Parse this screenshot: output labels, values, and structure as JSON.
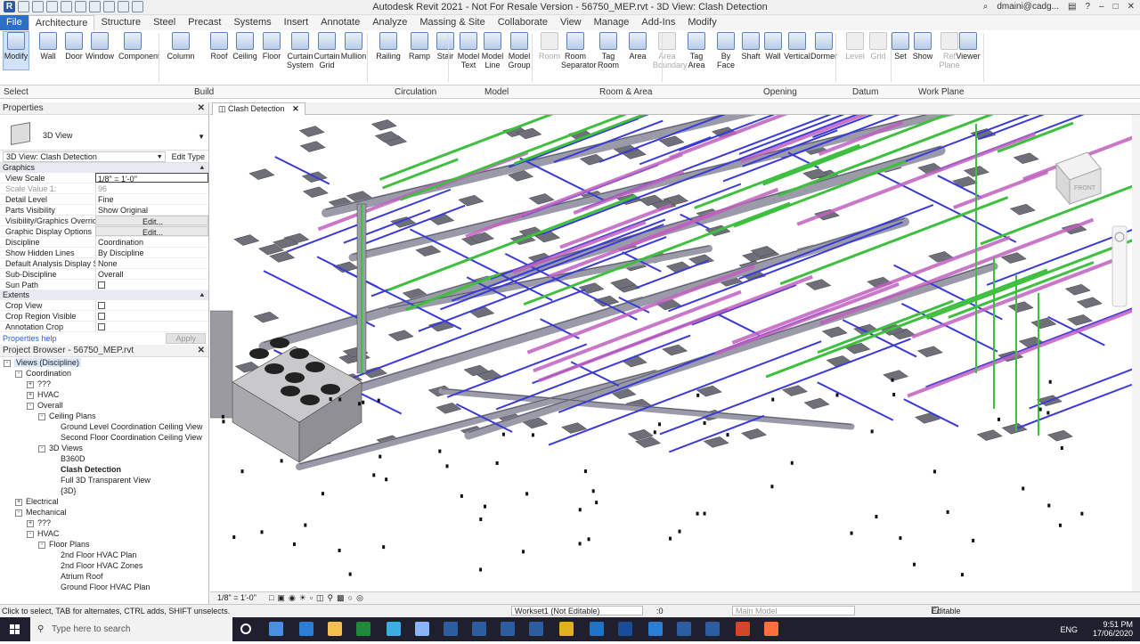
{
  "app": {
    "title": "Autodesk Revit 2021 - Not For Resale Version - 56750_MEP.rvt - 3D View: Clash Detection",
    "user": "dmaini@cadg..."
  },
  "tabs": [
    "File",
    "Architecture",
    "Structure",
    "Steel",
    "Precast",
    "Systems",
    "Insert",
    "Annotate",
    "Analyze",
    "Massing & Site",
    "Collaborate",
    "View",
    "Manage",
    "Add-Ins",
    "Modify"
  ],
  "active_tab": "Architecture",
  "ribbon": {
    "buttons": [
      {
        "label": "Modify",
        "icon": "cursor-icon"
      },
      {
        "label": "Wall",
        "icon": "wall-icon"
      },
      {
        "label": "Door",
        "icon": "door-icon"
      },
      {
        "label": "Window",
        "icon": "window-icon"
      },
      {
        "label": "Component",
        "icon": "component-icon"
      },
      {
        "label": "Column",
        "icon": "column-icon"
      },
      {
        "label": "Roof",
        "icon": "roof-icon"
      },
      {
        "label": "Ceiling",
        "icon": "ceiling-icon"
      },
      {
        "label": "Floor",
        "icon": "floor-icon"
      },
      {
        "label": "Curtain System",
        "icon": "curtain-system-icon"
      },
      {
        "label": "Curtain Grid",
        "icon": "curtain-grid-icon"
      },
      {
        "label": "Mullion",
        "icon": "mullion-icon"
      },
      {
        "label": "Railing",
        "icon": "railing-icon"
      },
      {
        "label": "Ramp",
        "icon": "ramp-icon"
      },
      {
        "label": "Stair",
        "icon": "stair-icon"
      },
      {
        "label": "Model Text",
        "icon": "model-text-icon"
      },
      {
        "label": "Model Line",
        "icon": "model-line-icon"
      },
      {
        "label": "Model Group",
        "icon": "model-group-icon"
      },
      {
        "label": "Room",
        "icon": "room-icon",
        "disabled": true
      },
      {
        "label": "Room Separator",
        "icon": "room-separator-icon"
      },
      {
        "label": "Tag Room",
        "icon": "tag-room-icon"
      },
      {
        "label": "Area",
        "icon": "area-icon"
      },
      {
        "label": "Area Boundary",
        "icon": "area-boundary-icon",
        "disabled": true
      },
      {
        "label": "Tag Area",
        "icon": "tag-area-icon"
      },
      {
        "label": "By Face",
        "icon": "by-face-icon"
      },
      {
        "label": "Shaft",
        "icon": "shaft-icon"
      },
      {
        "label": "Wall",
        "icon": "wall-opening-icon"
      },
      {
        "label": "Vertical",
        "icon": "vertical-icon"
      },
      {
        "label": "Dormer",
        "icon": "dormer-icon"
      },
      {
        "label": "Level",
        "icon": "level-icon",
        "disabled": true
      },
      {
        "label": "Grid",
        "icon": "grid-icon",
        "disabled": true
      },
      {
        "label": "Set",
        "icon": "set-icon"
      },
      {
        "label": "Show",
        "icon": "show-icon"
      },
      {
        "label": "Ref Plane",
        "icon": "ref-plane-icon",
        "disabled": true
      },
      {
        "label": "Viewer",
        "icon": "viewer-icon"
      }
    ],
    "panels": [
      "Select",
      "Build",
      "Circulation",
      "Model",
      "Room & Area",
      "Opening",
      "Datum",
      "Work Plane"
    ]
  },
  "properties": {
    "title": "Properties",
    "type": "3D View",
    "view_selector": "3D View: Clash Detection",
    "edit_type": "Edit Type",
    "sections": [
      {
        "name": "Graphics",
        "rows": [
          {
            "k": "View Scale",
            "v": "1/8\" = 1'-0\"",
            "style": "box"
          },
          {
            "k": "Scale Value    1:",
            "v": "96",
            "style": "dim"
          },
          {
            "k": "Detail Level",
            "v": "Fine"
          },
          {
            "k": "Parts Visibility",
            "v": "Show Original"
          },
          {
            "k": "Visibility/Graphics Overrides",
            "v": "Edit...",
            "style": "btn"
          },
          {
            "k": "Graphic Display Options",
            "v": "Edit...",
            "style": "btn"
          },
          {
            "k": "Discipline",
            "v": "Coordination"
          },
          {
            "k": "Show Hidden Lines",
            "v": "By Discipline"
          },
          {
            "k": "Default Analysis Display St...",
            "v": "None"
          },
          {
            "k": "Sub-Discipline",
            "v": "Overall"
          },
          {
            "k": "Sun Path",
            "v": "",
            "style": "check"
          }
        ]
      },
      {
        "name": "Extents",
        "rows": [
          {
            "k": "Crop View",
            "v": "",
            "style": "check"
          },
          {
            "k": "Crop Region Visible",
            "v": "",
            "style": "check"
          },
          {
            "k": "Annotation Crop",
            "v": "",
            "style": "check"
          }
        ]
      }
    ],
    "help": "Properties help",
    "apply": "Apply"
  },
  "browser": {
    "title": "Project Browser - 56750_MEP.rvt",
    "nodes": [
      {
        "d": 0,
        "t": "Views (Discipline)",
        "exp": "-",
        "sel": true
      },
      {
        "d": 1,
        "t": "Coordination",
        "exp": "-"
      },
      {
        "d": 2,
        "t": "???",
        "exp": "+"
      },
      {
        "d": 2,
        "t": "HVAC",
        "exp": "+"
      },
      {
        "d": 2,
        "t": "Overall",
        "exp": "-"
      },
      {
        "d": 3,
        "t": "Ceiling Plans",
        "exp": "-"
      },
      {
        "d": 4,
        "t": "Ground Level Coordination Ceiling View"
      },
      {
        "d": 4,
        "t": "Second Floor Coordination Ceiling View"
      },
      {
        "d": 3,
        "t": "3D Views",
        "exp": "-"
      },
      {
        "d": 4,
        "t": "B360D"
      },
      {
        "d": 4,
        "t": "Clash Detection",
        "bold": true
      },
      {
        "d": 4,
        "t": "Full 3D Transparent View"
      },
      {
        "d": 4,
        "t": "{3D}"
      },
      {
        "d": 1,
        "t": "Electrical",
        "exp": "+"
      },
      {
        "d": 1,
        "t": "Mechanical",
        "exp": "-"
      },
      {
        "d": 2,
        "t": "???",
        "exp": "+"
      },
      {
        "d": 2,
        "t": "HVAC",
        "exp": "-"
      },
      {
        "d": 3,
        "t": "Floor Plans",
        "exp": "-"
      },
      {
        "d": 4,
        "t": "2nd Floor HVAC Plan"
      },
      {
        "d": 4,
        "t": "2nd Floor HVAC Zones"
      },
      {
        "d": 4,
        "t": "Atrium Roof"
      },
      {
        "d": 4,
        "t": "Ground Floor HVAC Plan"
      }
    ]
  },
  "view": {
    "tab": "Clash Detection",
    "scale": "1/8\" = 1'-0\"",
    "viewcube_face": "FRONT"
  },
  "status": {
    "hint": "Click to select, TAB for alternates, CTRL adds, SHIFT unselects.",
    "workset": "Workset1 (Not Editable)",
    "count": ":0",
    "model": "Main Model",
    "editable_only": "Editable Only"
  },
  "taskbar": {
    "search": "Type here to search",
    "time": "9:51 PM",
    "date": "17/06/2020",
    "lang": "ENG"
  },
  "colors": {
    "accent": "#2d6ec7",
    "duct_gray": "#9a9aa8",
    "pipe_blue": "#3a3ad8",
    "pipe_green": "#3fbf3f",
    "pipe_magenta": "#c060c0"
  }
}
